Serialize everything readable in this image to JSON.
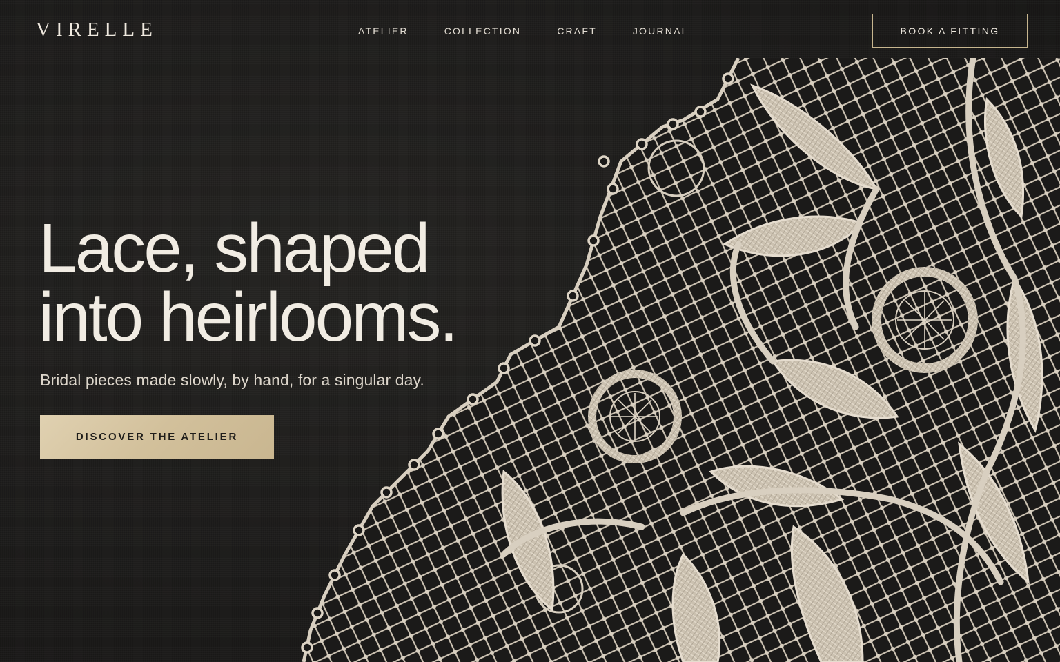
{
  "brand": {
    "logo": "VIRELLE"
  },
  "nav": {
    "items": [
      {
        "label": "ATELIER"
      },
      {
        "label": "COLLECTION"
      },
      {
        "label": "CRAFT"
      },
      {
        "label": "JOURNAL"
      }
    ],
    "cta_label": "BOOK A FITTING"
  },
  "hero": {
    "headline_line1": "Lace, shaped",
    "headline_line2": "into heirlooms.",
    "subheading": "Bridal pieces made slowly, by hand, for a singular day.",
    "cta_label": "DISCOVER THE ATELIER"
  },
  "colors": {
    "background": "#1f1e1d",
    "accent_gold": "#d2c09b",
    "lace": "#d8cfc0",
    "text": "#f1ece3"
  }
}
